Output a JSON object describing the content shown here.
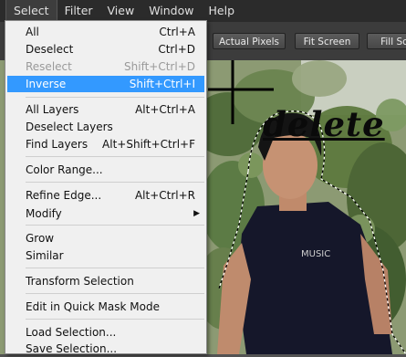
{
  "menubar": {
    "items": [
      {
        "label": "Select"
      },
      {
        "label": "Filter"
      },
      {
        "label": "View"
      },
      {
        "label": "Window"
      },
      {
        "label": "Help"
      }
    ]
  },
  "optionsbar": {
    "actual_pixels": "Actual Pixels",
    "fit_screen": "Fit Screen",
    "fill_screen": "Fill Sc"
  },
  "annotation": {
    "text": "delete"
  },
  "dropdown": {
    "items": [
      {
        "label": "All",
        "shortcut": "Ctrl+A"
      },
      {
        "label": "Deselect",
        "shortcut": "Ctrl+D"
      },
      {
        "label": "Reselect",
        "shortcut": "Shift+Ctrl+D"
      },
      {
        "label": "Inverse",
        "shortcut": "Shift+Ctrl+I"
      },
      {
        "label": "All Layers",
        "shortcut": "Alt+Ctrl+A"
      },
      {
        "label": "Deselect Layers",
        "shortcut": ""
      },
      {
        "label": "Find Layers",
        "shortcut": "Alt+Shift+Ctrl+F"
      },
      {
        "label": "Color Range...",
        "shortcut": ""
      },
      {
        "label": "Refine Edge...",
        "shortcut": "Alt+Ctrl+R"
      },
      {
        "label": "Modify",
        "shortcut": ""
      },
      {
        "label": "Grow",
        "shortcut": ""
      },
      {
        "label": "Similar",
        "shortcut": ""
      },
      {
        "label": "Transform Selection",
        "shortcut": ""
      },
      {
        "label": "Edit in Quick Mask Mode",
        "shortcut": ""
      },
      {
        "label": "Load Selection...",
        "shortcut": ""
      },
      {
        "label": "Save Selection...",
        "shortcut": ""
      }
    ]
  },
  "colors": {
    "highlight": "#3399ff",
    "menubar_bg": "#2b2b2b",
    "dropdown_bg": "#f0f0f0"
  }
}
